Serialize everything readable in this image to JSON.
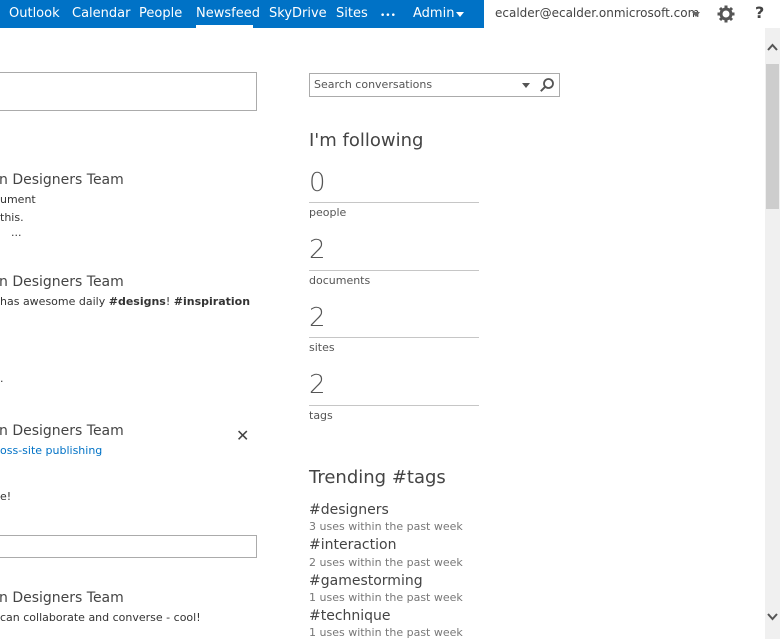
{
  "nav": {
    "outlook": "Outlook",
    "calendar": "Calendar",
    "people": "People",
    "newsfeed": "Newsfeed",
    "skydrive": "SkyDrive",
    "sites": "Sites",
    "more": "•••",
    "admin": "Admin"
  },
  "user": {
    "email": "ecalder@ecalder.onmicrosoft.com"
  },
  "help_label": "?",
  "search": {
    "placeholder": "Search conversations"
  },
  "feed": {
    "post1_title": "n Designers Team",
    "post1_line1": "ument",
    "post1_line2": "this.",
    "post1_more": "...",
    "post2_title": "n Designers Team",
    "post2_text_prefix": " has awesome daily ",
    "post2_tag1": "#designs",
    "post2_sep": "! ",
    "post2_tag2": "#inspiration",
    "stray": ".",
    "post3_title": "n Designers Team",
    "post3_link": "oss-site publishing",
    "post3_text": "e!",
    "post4_title": "n Designers Team",
    "post4_text": " can collaborate and converse - cool!"
  },
  "following": {
    "title": "I'm following",
    "items": [
      {
        "count": "0",
        "label": "people"
      },
      {
        "count": "2",
        "label": "documents"
      },
      {
        "count": "2",
        "label": "sites"
      },
      {
        "count": "2",
        "label": "tags"
      }
    ]
  },
  "trending": {
    "title": "Trending #tags",
    "tags": [
      {
        "tag": "#designers",
        "uses": "3 uses within the past week"
      },
      {
        "tag": "#interaction",
        "uses": "2 uses within the past week"
      },
      {
        "tag": "#gamestorming",
        "uses": "1 uses within the past week"
      },
      {
        "tag": "#technique",
        "uses": "1 uses within the past week"
      }
    ]
  },
  "colors": {
    "suite_bar": "#0072c6",
    "link": "#0072c6"
  }
}
